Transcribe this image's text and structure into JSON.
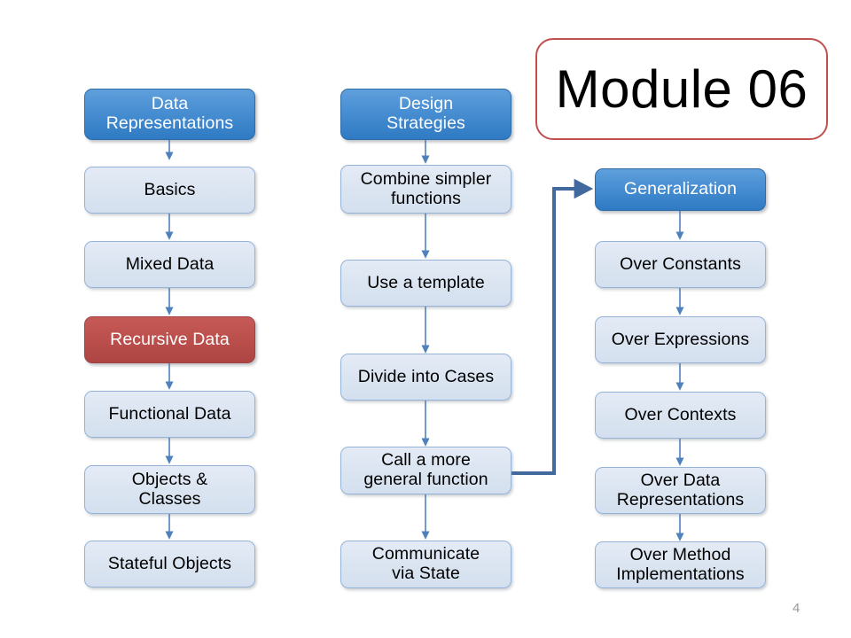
{
  "slide": {
    "title": "Module 06",
    "page_number": "4",
    "background_color": "#ffffff",
    "accent_blue": "#4a90d3",
    "accent_light_blue": "#dbe5f1",
    "accent_red": "#bc504d",
    "border_blue": "#95b3d7",
    "connector_color": "#4f81bd",
    "title_border_color": "#c0504d"
  },
  "columns": [
    {
      "id": "data-representations",
      "header": {
        "label": "Data\nRepresentations",
        "style": "blue"
      },
      "items": [
        {
          "label": "Basics",
          "style": "light"
        },
        {
          "label": "Mixed Data",
          "style": "light"
        },
        {
          "label": "Recursive Data",
          "style": "red"
        },
        {
          "label": "Functional Data",
          "style": "light"
        },
        {
          "label": "Objects &\nClasses",
          "style": "light"
        },
        {
          "label": "Stateful Objects",
          "style": "light"
        }
      ]
    },
    {
      "id": "design-strategies",
      "header": {
        "label": "Design\nStrategies",
        "style": "blue"
      },
      "items": [
        {
          "label": "Combine simpler\nfunctions",
          "style": "light"
        },
        {
          "label": "Use a template",
          "style": "light"
        },
        {
          "label": "Divide into Cases",
          "style": "light"
        },
        {
          "label": "Call a more\ngeneral function",
          "style": "light"
        },
        {
          "label": "Communicate\nvia State",
          "style": "light"
        }
      ]
    },
    {
      "id": "generalization",
      "header": {
        "label": "Generalization",
        "style": "blue"
      },
      "items": [
        {
          "label": "Over Constants",
          "style": "light"
        },
        {
          "label": "Over Expressions",
          "style": "light"
        },
        {
          "label": "Over Contexts",
          "style": "light"
        },
        {
          "label": "Over Data\nRepresentations",
          "style": "light"
        },
        {
          "label": "Over Method\nImplementations",
          "style": "light"
        }
      ]
    }
  ],
  "cross_link": {
    "from": "Call a more general function",
    "to": "Generalization"
  }
}
